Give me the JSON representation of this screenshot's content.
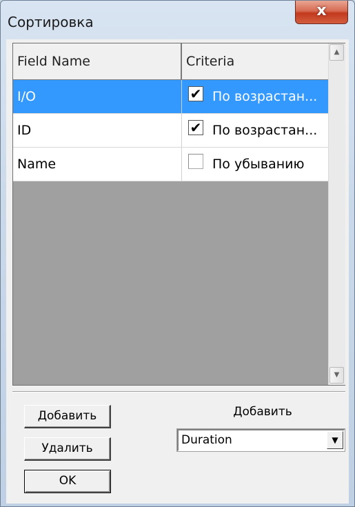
{
  "window": {
    "title": "Сортировка",
    "close_label": "x"
  },
  "grid": {
    "columns": [
      "Field Name",
      "Criteria"
    ],
    "rows": [
      {
        "field": "I/O",
        "criteria": "По возрастан...",
        "checked": true,
        "selected": true
      },
      {
        "field": "ID",
        "criteria": "По возрастан...",
        "checked": true,
        "selected": false
      },
      {
        "field": "Name",
        "criteria": "По убыванию",
        "checked": false,
        "selected": false
      }
    ],
    "check_glyph": "✔",
    "scroll_up_icon": "▲",
    "scroll_down_icon": "▼"
  },
  "buttons": {
    "add": "Добавить",
    "remove": "Удалить",
    "ok": "OK"
  },
  "add_section": {
    "label": "Добавить",
    "combo_value": "Duration",
    "combo_arrow": "▼"
  },
  "colors": {
    "selection": "#3399ff",
    "close_button": "#c2391e",
    "grid_background": "#a0a0a0"
  }
}
